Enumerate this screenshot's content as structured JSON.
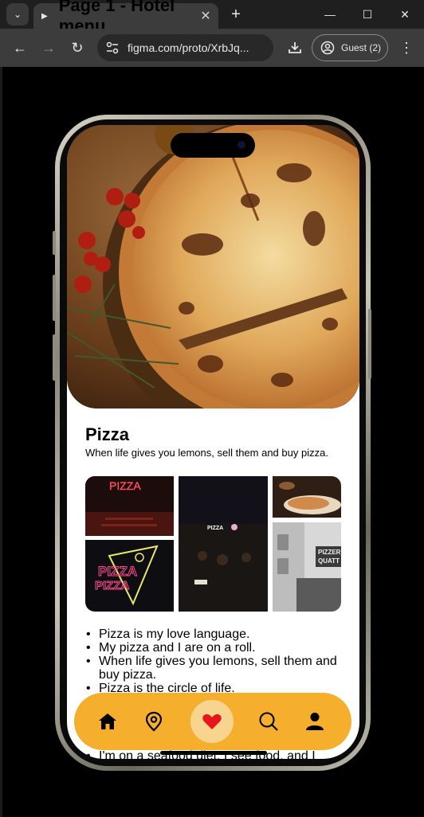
{
  "browser": {
    "tab_title": "Page 1 - Hotel menu",
    "url": "figma.com/proto/XrbJq...",
    "guest_label": "Guest (2)"
  },
  "page": {
    "title": "Pizza",
    "subtitle": "When life gives you lemons, sell them and buy pizza.",
    "gallery": [
      "PIZZA neon sign",
      "Pizza street at night",
      "Pizza slices",
      "Neon pizza slice",
      "Pizzeria storefront"
    ],
    "bullets": [
      "Pizza is my love language.",
      "My pizza and I are on a roll.",
      "When life gives you lemons, sell them and buy pizza.",
      "Pizza is the circle of life."
    ],
    "partial_bullet": "I'm on a seafood diet. I see food, and I"
  },
  "nav": {
    "items": [
      {
        "name": "home-icon"
      },
      {
        "name": "location-pin-icon"
      },
      {
        "name": "heart-icon",
        "active": true
      },
      {
        "name": "search-icon"
      },
      {
        "name": "user-icon"
      }
    ]
  },
  "colors": {
    "accent": "#f6ae2d",
    "accent_light": "#f7d58f",
    "heart": "#e8151a",
    "browser_bg": "#1f1f1f",
    "toolbar_bg": "#3c3c3c"
  }
}
